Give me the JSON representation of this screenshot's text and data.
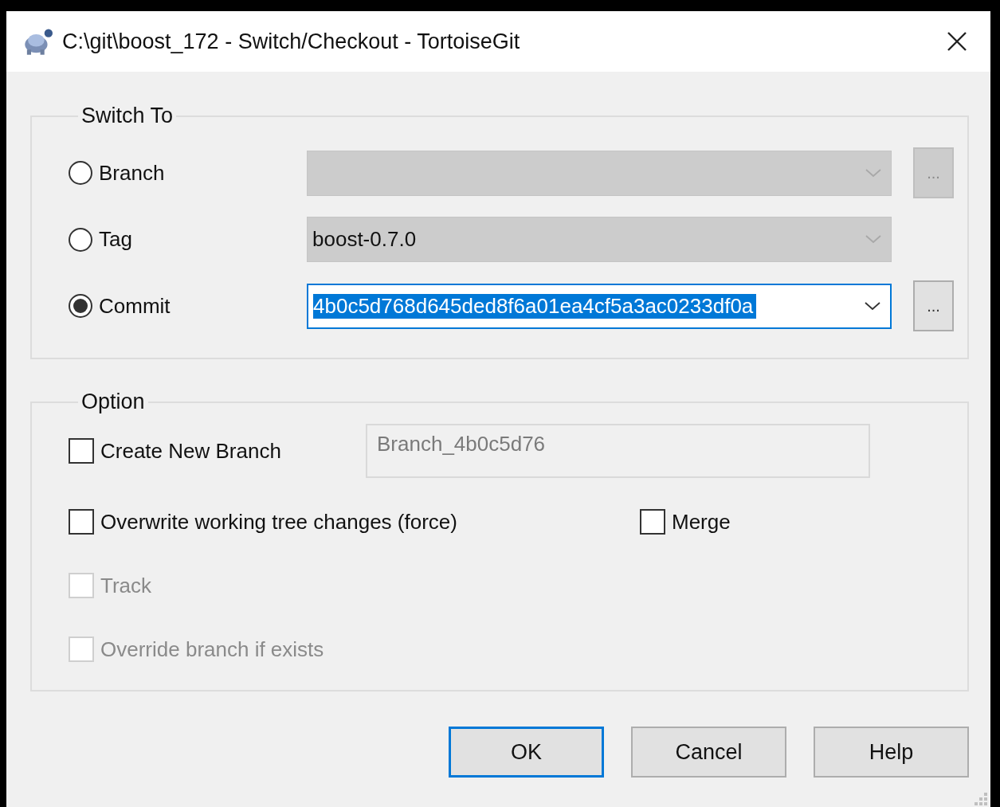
{
  "window": {
    "title": "C:\\git\\boost_172 - Switch/Checkout - TortoiseGit"
  },
  "switch_to": {
    "title": "Switch To",
    "options": [
      {
        "label": "Branch",
        "selected": false,
        "combo": {
          "disabled": true,
          "text_selected": false
        },
        "browse": {
          "label": "...",
          "disabled": true
        }
      },
      {
        "label": "Tag",
        "selected": false,
        "combo": {
          "value": "boost-0.7.0",
          "disabled": true,
          "text_selected": false
        }
      },
      {
        "label": "Commit",
        "selected": true,
        "combo": {
          "value": "4b0c5d768d645ded8f6a01ea4cf5a3ac0233df0a",
          "disabled": false,
          "text_selected": true
        },
        "browse": {
          "label": "...",
          "disabled": false
        }
      }
    ]
  },
  "option": {
    "title": "Option",
    "items": [
      {
        "kind": "checkbox-field",
        "label": "Create New Branch",
        "checked": false,
        "disabled": false,
        "field": {
          "value": "Branch_4b0c5d76",
          "disabled": true
        }
      },
      {
        "kind": "checkbox-pair",
        "label": "Overwrite working tree changes (force)",
        "checked": false,
        "disabled": false,
        "second": {
          "label": "Merge",
          "checked": false,
          "disabled": false
        }
      },
      {
        "kind": "checkbox",
        "label": "Track",
        "checked": false,
        "disabled": true
      },
      {
        "kind": "checkbox",
        "label": "Override branch if exists",
        "checked": false,
        "disabled": true
      }
    ]
  },
  "buttons": [
    {
      "label": "OK",
      "default": true
    },
    {
      "label": "Cancel",
      "default": false
    },
    {
      "label": "Help",
      "default": false
    }
  ]
}
